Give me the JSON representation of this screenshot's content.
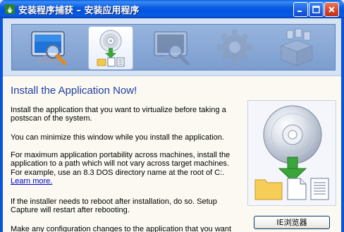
{
  "window": {
    "title": "安装程序捕获 – 安装应用程序"
  },
  "steps": [
    {
      "name": "scan-step",
      "icon": "monitor-magnifier-icon",
      "active": false
    },
    {
      "name": "install-step",
      "icon": "cd-install-icon",
      "active": true
    },
    {
      "name": "rescan-step",
      "icon": "monitor-magnifier-icon",
      "active": false
    },
    {
      "name": "configure-step",
      "icon": "gear-icon",
      "active": false
    },
    {
      "name": "package-step",
      "icon": "package-box-icon",
      "active": false
    }
  ],
  "content": {
    "heading": "Install the Application Now!",
    "para1": "Install the application that you want to virtualize before taking a postscan of the system.",
    "para2": "You can minimize this window while you install the application.",
    "para3": "For maximum application portability across machines, install the application to a path which will not vary across target machines. For example, use an 8.3 DOS directory name at the root of C:.",
    "learn_more": "Learn more.",
    "para4": "If the installer needs to reboot after installation, do so. Setup Capture will restart after rebooting.",
    "para5": "Make any configuration changes to the application that you want to"
  },
  "sidebar": {
    "ie_button": "IE浏览器"
  },
  "colors": {
    "titlebar": "#0054e3",
    "heading": "#1f3f9e",
    "link": "#0000cc",
    "header_band": "#d6e3f5"
  }
}
